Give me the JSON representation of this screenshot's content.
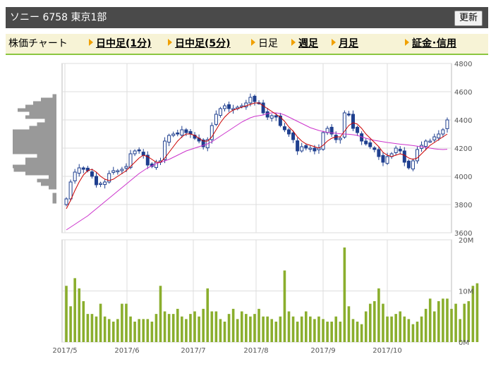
{
  "header": {
    "title": "ソニー 6758 東京1部",
    "refresh_label": "更新"
  },
  "tabs": [
    {
      "label": "株価チャート",
      "link": false
    },
    {
      "label": "日中足(1分)",
      "link": true
    },
    {
      "label": "日中足(5分)",
      "link": true
    },
    {
      "label": "日足",
      "link": false
    },
    {
      "label": "週足",
      "link": true
    },
    {
      "label": "月足",
      "link": true
    },
    {
      "label": "証金･信用",
      "link": true
    }
  ],
  "colors": {
    "candle": "#1f3f8f",
    "ma_short": "#cc0000",
    "ma_long": "#cc33cc",
    "volume": "#8aae2d",
    "profile": "#999999",
    "accent_tab": "#8cc63f"
  },
  "chart_data": {
    "type": "candlestick",
    "x_labels": [
      "2017/5",
      "2017/6",
      "2017/7",
      "2017/8",
      "2017/9",
      "2017/10"
    ],
    "price_axis": {
      "ticks": [
        3600,
        3800,
        4000,
        4200,
        4400,
        4600,
        4800
      ],
      "ylim": [
        3600,
        4800
      ]
    },
    "volume_axis": {
      "ticks": [
        "0M",
        "10M",
        "20M"
      ],
      "ylim": [
        0,
        20
      ]
    },
    "closes": [
      3840,
      3960,
      4030,
      4060,
      4050,
      4040,
      4000,
      3940,
      3950,
      3960,
      4020,
      4040,
      4040,
      4050,
      4070,
      4160,
      4180,
      4180,
      4150,
      4080,
      4070,
      4100,
      4110,
      4250,
      4290,
      4300,
      4300,
      4330,
      4310,
      4300,
      4270,
      4250,
      4210,
      4260,
      4360,
      4440,
      4480,
      4500,
      4480,
      4480,
      4490,
      4500,
      4520,
      4560,
      4530,
      4520,
      4450,
      4420,
      4430,
      4420,
      4360,
      4330,
      4300,
      4260,
      4180,
      4210,
      4200,
      4200,
      4180,
      4200,
      4310,
      4340,
      4300,
      4260,
      4270,
      4450,
      4440,
      4340,
      4310,
      4250,
      4230,
      4210,
      4190,
      4140,
      4100,
      4140,
      4160,
      4200,
      4180,
      4100,
      4060,
      4110,
      4190,
      4220,
      4250,
      4250,
      4280,
      4300,
      4330,
      4400
    ],
    "ma_short": [
      3770,
      3830,
      3900,
      3960,
      4010,
      4040,
      4050,
      4030,
      4000,
      3980,
      3970,
      3980,
      4000,
      4020,
      4040,
      4070,
      4100,
      4130,
      4150,
      4140,
      4120,
      4100,
      4100,
      4130,
      4170,
      4210,
      4250,
      4280,
      4300,
      4300,
      4290,
      4270,
      4250,
      4250,
      4280,
      4330,
      4380,
      4420,
      4450,
      4470,
      4480,
      4490,
      4500,
      4510,
      4520,
      4520,
      4500,
      4480,
      4460,
      4440,
      4420,
      4390,
      4350,
      4320,
      4280,
      4250,
      4230,
      4220,
      4210,
      4200,
      4220,
      4250,
      4270,
      4280,
      4280,
      4320,
      4360,
      4380,
      4370,
      4340,
      4300,
      4270,
      4240,
      4210,
      4170,
      4150,
      4140,
      4150,
      4160,
      4150,
      4130,
      4120,
      4130,
      4160,
      4190,
      4220,
      4240,
      4260,
      4280,
      4300
    ],
    "ma_long": [
      3620,
      3640,
      3660,
      3680,
      3700,
      3720,
      3745,
      3770,
      3795,
      3820,
      3845,
      3870,
      3895,
      3920,
      3945,
      3970,
      3995,
      4020,
      4040,
      4060,
      4075,
      4090,
      4100,
      4110,
      4120,
      4135,
      4150,
      4165,
      4180,
      4190,
      4200,
      4210,
      4220,
      4230,
      4245,
      4265,
      4285,
      4305,
      4325,
      4345,
      4365,
      4385,
      4400,
      4415,
      4425,
      4430,
      4435,
      4445,
      4450,
      4450,
      4445,
      4435,
      4420,
      4405,
      4390,
      4375,
      4360,
      4345,
      4335,
      4325,
      4318,
      4312,
      4308,
      4305,
      4302,
      4300,
      4298,
      4295,
      4290,
      4280,
      4270,
      4262,
      4255,
      4250,
      4245,
      4240,
      4236,
      4232,
      4228,
      4225,
      4222,
      4218,
      4214,
      4210,
      4205,
      4200,
      4195,
      4192,
      4190,
      4192
    ],
    "volumes_m": [
      11,
      7,
      12.5,
      10.5,
      8,
      5.5,
      5.5,
      5,
      7.5,
      5,
      4.5,
      4,
      4.5,
      7.5,
      7.5,
      5,
      4,
      4.5,
      4.5,
      4.5,
      4,
      5.5,
      11,
      6,
      5.5,
      5.5,
      6.5,
      5,
      4.5,
      5.5,
      6,
      5,
      6.5,
      10.5,
      6,
      6,
      4.5,
      4,
      5.5,
      6.5,
      4.5,
      6,
      5.5,
      5,
      5.5,
      6.5,
      5,
      5,
      4.5,
      4,
      5,
      14,
      6,
      5,
      4,
      5,
      6,
      5,
      4.5,
      5,
      4.5,
      4,
      4,
      5,
      4,
      18.5,
      7,
      4.5,
      4,
      3.5,
      6,
      7.5,
      8,
      10.5,
      7.5,
      5,
      5,
      5.5,
      6,
      5,
      4.5,
      3.5,
      4,
      5,
      6.5,
      8.5,
      6,
      8,
      8.5,
      8.5,
      6.5,
      7.5,
      4.5,
      7.5,
      8,
      11,
      11.5
    ]
  }
}
